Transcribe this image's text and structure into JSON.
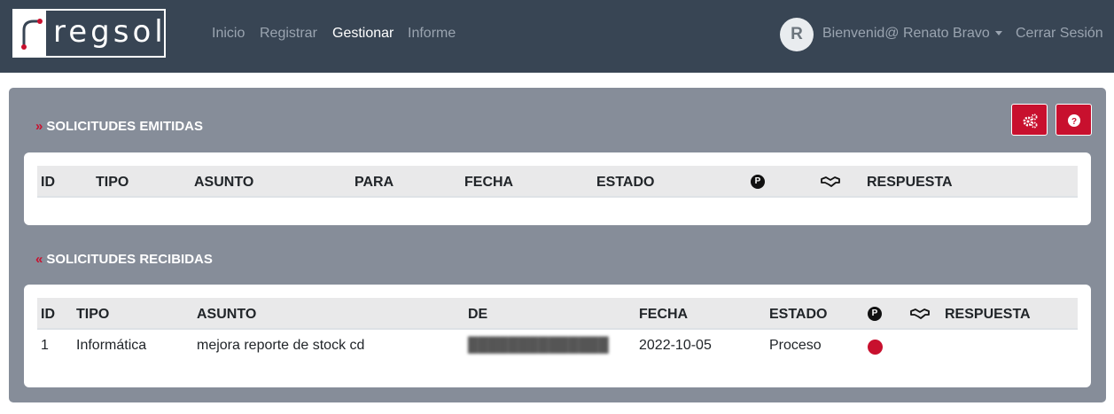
{
  "navbar": {
    "logo_text": "regsol",
    "links": [
      {
        "label": "Inicio",
        "active": false
      },
      {
        "label": "Registrar",
        "active": false
      },
      {
        "label": "Gestionar",
        "active": true
      },
      {
        "label": "Informe",
        "active": false
      }
    ],
    "avatar_initial": "R",
    "user_greeting": "Bienvenid@ Renato Bravo",
    "logout_label": "Cerrar Sesión"
  },
  "emitidas": {
    "title": "SOLICITUDES EMITIDAS",
    "chevron": "»",
    "columns": [
      "ID",
      "TIPO",
      "ASUNTO",
      "PARA",
      "FECHA",
      "ESTADO",
      "P-icon",
      "handshake-icon",
      "RESPUESTA"
    ],
    "rows": []
  },
  "recibidas": {
    "title": "SOLICITUDES RECIBIDAS",
    "chevron": "«",
    "columns": [
      "ID",
      "TIPO",
      "ASUNTO",
      "DE",
      "FECHA",
      "ESTADO",
      "P-icon",
      "handshake-icon",
      "RESPUESTA"
    ],
    "rows": [
      {
        "id": "1",
        "tipo": "Informática",
        "asunto": "mejora reporte de stock cd",
        "de": "██████████████",
        "fecha": "2022-10-05",
        "estado": "Proceso",
        "priority_color": "#c8102e",
        "respuesta": ""
      }
    ]
  },
  "toolbar": {
    "settings_icon": "gears-icon",
    "help_icon": "question-circle-icon"
  },
  "colors": {
    "navbar_bg": "#384554",
    "panel_bg": "#868d99",
    "accent_red": "#c8102e"
  }
}
